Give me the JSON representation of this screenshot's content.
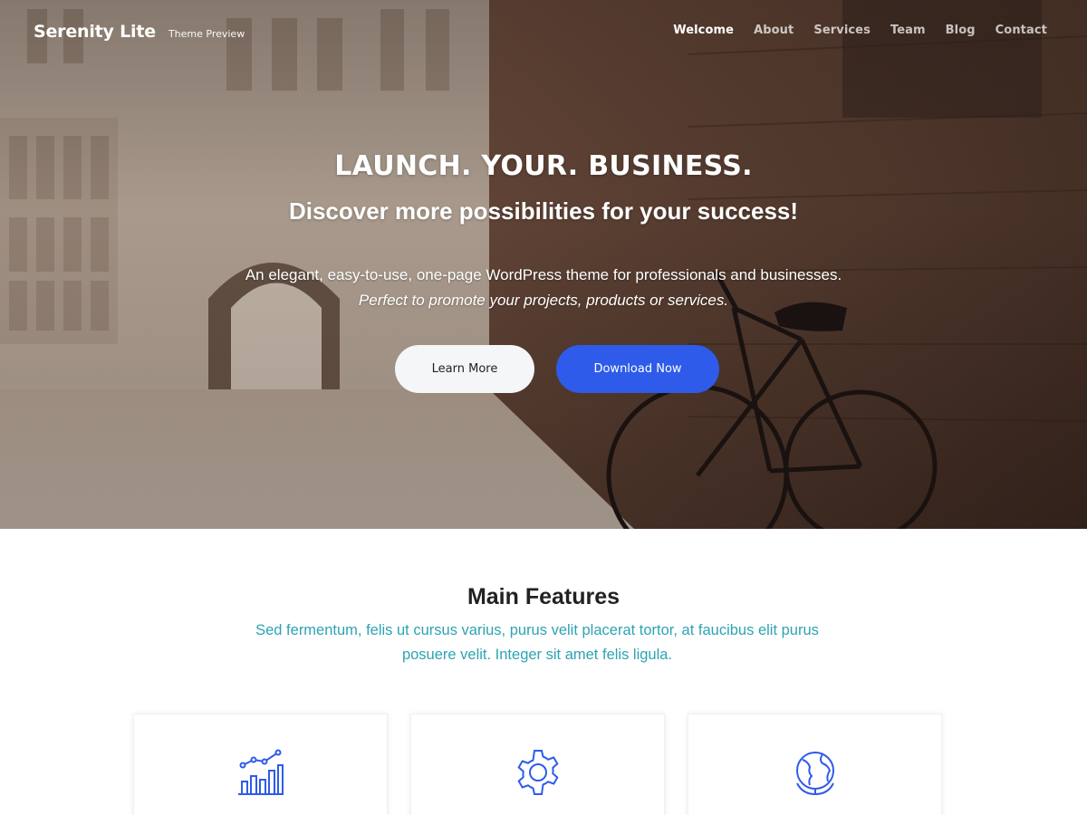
{
  "header": {
    "site_title": "Serenity Lite",
    "tagline": "Theme Preview",
    "nav": [
      {
        "label": "Welcome",
        "active": true
      },
      {
        "label": "About",
        "active": false
      },
      {
        "label": "Services",
        "active": false
      },
      {
        "label": "Team",
        "active": false
      },
      {
        "label": "Blog",
        "active": false
      },
      {
        "label": "Contact",
        "active": false
      }
    ]
  },
  "hero": {
    "title": "LAUNCH. YOUR. BUSINESS.",
    "subtitle": "Discover more possibilities for your success!",
    "description": "An elegant, easy-to-use, one-page WordPress theme for professionals and businesses.",
    "description_italic": "Perfect to promote your projects, products or services.",
    "learn_more_label": "Learn More",
    "download_label": "Download Now"
  },
  "features": {
    "title": "Main Features",
    "description": "Sed fermentum, felis ut cursus varius, purus velit placerat tortor, at faucibus elit purus posuere velit. Integer sit amet felis ligula.",
    "cards": [
      {
        "icon": "chart-icon"
      },
      {
        "icon": "gear-icon"
      },
      {
        "icon": "globe-icon"
      }
    ]
  },
  "colors": {
    "accent": "#2f5bea",
    "teal_text": "#2ea3b3"
  }
}
